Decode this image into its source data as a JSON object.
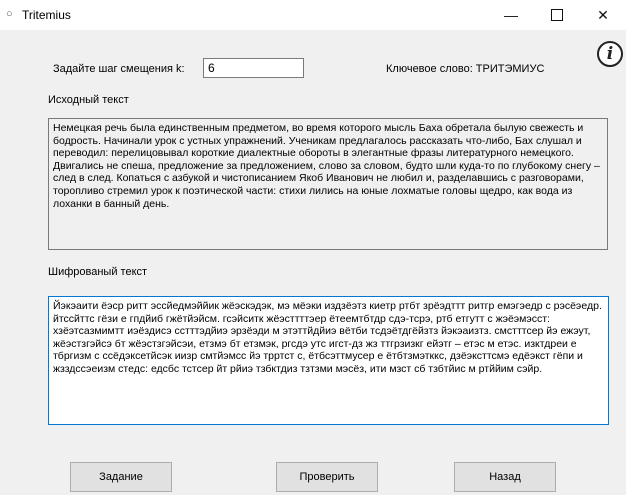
{
  "window": {
    "title": "Tritemius",
    "app_icon": "○",
    "minimize_glyph": "—",
    "close_glyph": "✕"
  },
  "info": {
    "glyph": "i",
    "icon_name": "info-icon"
  },
  "shift": {
    "label": "Задайте шаг смещения k:",
    "value": "6"
  },
  "keyword_label": "Ключевое слово: ТРИТЭМИУС",
  "source": {
    "label": "Исходный текст",
    "text": "Немецкая речь была единственным предметом, во время которого мысль Баха обретала былую свежесть и бодрость. Начинали урок с устных упражнений. Ученикам предлагалось рассказать что-либо, Бах слушал и переводил: перелицовывал короткие диалектные обороты в элегантные фразы литературного немецкого. Двигались не спеша, предложение за предложением, слово за словом, будто шли куда-то по глубокому снегу – след в след. Копаться с азбукой и чистописанием Якоб Иванович не любил и, разделавшись с разговорами, торопливо стремил урок к поэтической части: стихи лились на юные лохматые головы щедро, как вода из лоханки в банный день."
  },
  "cipher": {
    "label": "Шифрованый текст",
    "text": "Йэкэаити ёэср ритт эссйедмэййик жёэскэдэк, мэ мёэки издзёэтз киетр ртбт зрёэдттт ритгр емэгэедр с рэсёэедр. йтссйттс гёзи е гпдйиб гжётйэйсм. гсэйситк жёэсттттэер ётеемтбтдр сдэ-тсрэ, ртб етгутт с жэёэмэсст: хзёэтсазмимтт иэёздисэ сстттэдйиэ эрзёэди м этэттйдйиэ вётби тсдэётдгёйзтз йэкэаизтз. смстттсер йэ ежэут, жёэстзгэйсэ бт жёэстзгэйсэи, етзмэ бт етзмэк, ргсдэ утс игст-дз жз ттгрзизкг ейэтг – етэс м етэс. изктдреи е тбргизм с ссёдэксетйсэк иизр смтйэмсс йэ трртст с, ётбсэттмусер е ётбтзмэтккс, дзёэксттсмэ едёэкст гёпи и жзздссэеизм стедс: едсбс тстсер йт рйиэ тзбктдиз тзтзми мэсёз, ити мзст сб тзбтйис м ртййим сэйр."
  },
  "buttons": {
    "task": "Задание",
    "check": "Проверить",
    "back": "Назад"
  }
}
